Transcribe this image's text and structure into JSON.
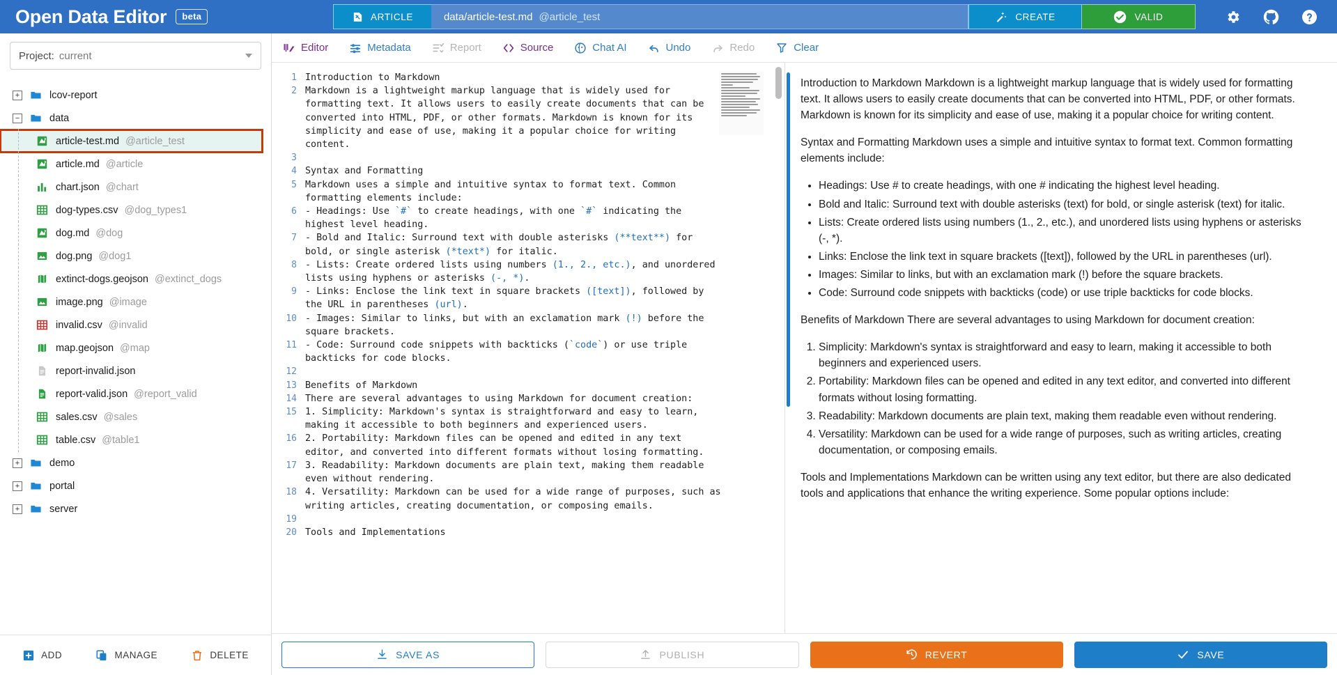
{
  "app": {
    "title": "Open Data Editor",
    "badge": "beta"
  },
  "topbar": {
    "file_type_label": "ARTICLE",
    "file_type_icon": "article-icon",
    "file_path": "data/article-test.md",
    "file_tag": "@article_test",
    "create_label": "CREATE",
    "create_icon": "magic-wand-icon",
    "valid_label": "VALID",
    "valid_icon": "check-circle-icon",
    "icons": [
      {
        "name": "gear-icon"
      },
      {
        "name": "github-icon"
      },
      {
        "name": "help-icon"
      }
    ],
    "colors": {
      "header_blue": "#2f6fc4",
      "chip_blue": "#0b8ec9",
      "valid_green": "#2e9e3b"
    }
  },
  "sidebar": {
    "project_label": "Project:",
    "project_value": "current",
    "tree": [
      {
        "kind": "folder",
        "name": "lcov-report",
        "tag": "",
        "expanded": false,
        "icon": "folder-icon",
        "selected": false
      },
      {
        "kind": "folder",
        "name": "data",
        "tag": "",
        "expanded": true,
        "icon": "folder-icon",
        "selected": false
      },
      {
        "kind": "file",
        "name": "article-test.md",
        "tag": "@article_test",
        "icon": "markdown-icon",
        "selected": true
      },
      {
        "kind": "file",
        "name": "article.md",
        "tag": "@article",
        "icon": "markdown-icon",
        "selected": false
      },
      {
        "kind": "file",
        "name": "chart.json",
        "tag": "@chart",
        "icon": "chart-icon",
        "selected": false
      },
      {
        "kind": "file",
        "name": "dog-types.csv",
        "tag": "@dog_types1",
        "icon": "table-icon",
        "selected": false
      },
      {
        "kind": "file",
        "name": "dog.md",
        "tag": "@dog",
        "icon": "markdown-icon",
        "selected": false
      },
      {
        "kind": "file",
        "name": "dog.png",
        "tag": "@dog1",
        "icon": "image-icon",
        "selected": false
      },
      {
        "kind": "file",
        "name": "extinct-dogs.geojson",
        "tag": "@extinct_dogs",
        "icon": "map-icon",
        "selected": false
      },
      {
        "kind": "file",
        "name": "image.png",
        "tag": "@image",
        "icon": "image-icon",
        "selected": false
      },
      {
        "kind": "file",
        "name": "invalid.csv",
        "tag": "@invalid",
        "icon": "table-invalid-icon",
        "selected": false
      },
      {
        "kind": "file",
        "name": "map.geojson",
        "tag": "@map",
        "icon": "map-icon",
        "selected": false
      },
      {
        "kind": "file",
        "name": "report-invalid.json",
        "tag": "",
        "icon": "document-grey-icon",
        "selected": false
      },
      {
        "kind": "file",
        "name": "report-valid.json",
        "tag": "@report_valid",
        "icon": "document-green-icon",
        "selected": false
      },
      {
        "kind": "file",
        "name": "sales.csv",
        "tag": "@sales",
        "icon": "table-icon",
        "selected": false
      },
      {
        "kind": "file",
        "name": "table.csv",
        "tag": "@table1",
        "icon": "table-icon",
        "selected": false
      },
      {
        "kind": "folder",
        "name": "demo",
        "tag": "",
        "expanded": false,
        "icon": "folder-icon",
        "selected": false
      },
      {
        "kind": "folder",
        "name": "portal",
        "tag": "",
        "expanded": false,
        "icon": "folder-icon",
        "selected": false
      },
      {
        "kind": "folder",
        "name": "server",
        "tag": "",
        "expanded": false,
        "icon": "folder-icon",
        "selected": false
      }
    ],
    "actions": [
      {
        "label": "ADD",
        "icon": "plus-square-icon",
        "color": "#1e7ec8"
      },
      {
        "label": "MANAGE",
        "icon": "copy-icon",
        "color": "#1e7ec8"
      },
      {
        "label": "DELETE",
        "icon": "trash-icon",
        "color": "#e8711a"
      }
    ]
  },
  "editor_toolbar": [
    {
      "label": "Editor",
      "icon": "editor-icon",
      "state": "purple"
    },
    {
      "label": "Metadata",
      "icon": "metadata-icon",
      "state": "blue"
    },
    {
      "label": "Report",
      "icon": "report-icon",
      "state": "dim"
    },
    {
      "label": "Source",
      "icon": "code-icon",
      "state": "purple"
    },
    {
      "label": "Chat AI",
      "icon": "chat-ai-icon",
      "state": "blue"
    },
    {
      "label": "Undo",
      "icon": "undo-icon",
      "state": "blue"
    },
    {
      "label": "Redo",
      "icon": "redo-icon",
      "state": "dim"
    },
    {
      "label": "Clear",
      "icon": "clear-icon",
      "state": "blue"
    }
  ],
  "code": {
    "lines": [
      {
        "no": "1",
        "text": "Introduction to Markdown"
      },
      {
        "no": "2",
        "text": "Markdown is a lightweight markup language that is widely used for formatting text. It allows users to easily create documents that can be converted into HTML, PDF, or other formats. Markdown is known for its simplicity and ease of use, making it a popular choice for writing content."
      },
      {
        "no": "3",
        "text": ""
      },
      {
        "no": "4",
        "text": "Syntax and Formatting"
      },
      {
        "no": "5",
        "text": "Markdown uses a simple and intuitive syntax to format text. Common formatting elements include:"
      },
      {
        "no": "6",
        "text": "- Headings: Use `#` to create headings, with one `#` indicating the highest level heading."
      },
      {
        "no": "7",
        "text": "- Bold and Italic: Surround text with double asterisks (**text**) for bold, or single asterisk (*text*) for italic."
      },
      {
        "no": "8",
        "text": "- Lists: Create ordered lists using numbers (1., 2., etc.), and unordered lists using hyphens or asterisks (-, *)."
      },
      {
        "no": "9",
        "text": "- Links: Enclose the link text in square brackets ([text]), followed by the URL in parentheses (url)."
      },
      {
        "no": "10",
        "text": "- Images: Similar to links, but with an exclamation mark (!) before the square brackets."
      },
      {
        "no": "11",
        "text": "- Code: Surround code snippets with backticks (`code`) or use triple backticks for code blocks."
      },
      {
        "no": "12",
        "text": ""
      },
      {
        "no": "13",
        "text": "Benefits of Markdown"
      },
      {
        "no": "14",
        "text": "There are several advantages to using Markdown for document creation:"
      },
      {
        "no": "15",
        "text": "1. Simplicity: Markdown's syntax is straightforward and easy to learn, making it accessible to both beginners and experienced users."
      },
      {
        "no": "16",
        "text": "2. Portability: Markdown files can be opened and edited in any text editor, and converted into different formats without losing formatting."
      },
      {
        "no": "17",
        "text": "3. Readability: Markdown documents are plain text, making them readable even without rendering."
      },
      {
        "no": "18",
        "text": "4. Versatility: Markdown can be used for a wide range of purposes, such as writing articles, creating documentation, or composing emails."
      },
      {
        "no": "19",
        "text": ""
      },
      {
        "no": "20",
        "text": "Tools and Implementations"
      }
    ]
  },
  "preview": {
    "blocks": [
      {
        "type": "p",
        "text": "Introduction to Markdown Markdown is a lightweight markup language that is widely used for formatting text. It allows users to easily create documents that can be converted into HTML, PDF, or other formats. Markdown is known for its simplicity and ease of use, making it a popular choice for writing content."
      },
      {
        "type": "p",
        "text": "Syntax and Formatting Markdown uses a simple and intuitive syntax to format text. Common formatting elements include:"
      },
      {
        "type": "ul",
        "items": [
          "Headings: Use # to create headings, with one # indicating the highest level heading.",
          "Bold and Italic: Surround text with double asterisks (text) for bold, or single asterisk (text) for italic.",
          "Lists: Create ordered lists using numbers (1., 2., etc.), and unordered lists using hyphens or asterisks (-, *).",
          "Links: Enclose the link text in square brackets ([text]), followed by the URL in parentheses (url).",
          "Images: Similar to links, but with an exclamation mark (!) before the square brackets.",
          "Code: Surround code snippets with backticks (code) or use triple backticks for code blocks."
        ]
      },
      {
        "type": "p",
        "text": "Benefits of Markdown There are several advantages to using Markdown for document creation:"
      },
      {
        "type": "ol",
        "items": [
          "Simplicity: Markdown's syntax is straightforward and easy to learn, making it accessible to both beginners and experienced users.",
          "Portability: Markdown files can be opened and edited in any text editor, and converted into different formats without losing formatting.",
          "Readability: Markdown documents are plain text, making them readable even without rendering.",
          "Versatility: Markdown can be used for a wide range of purposes, such as writing articles, creating documentation, or composing emails."
        ]
      },
      {
        "type": "p",
        "text": "Tools and Implementations Markdown can be written using any text editor, but there are also dedicated tools and applications that enhance the writing experience. Some popular options include:"
      }
    ]
  },
  "bottombar": {
    "save_as_label": "SAVE AS",
    "save_as_icon": "download-icon",
    "publish_label": "PUBLISH",
    "publish_icon": "upload-icon",
    "revert_label": "REVERT",
    "revert_icon": "history-icon",
    "save_label": "SAVE",
    "save_icon": "check-icon"
  }
}
